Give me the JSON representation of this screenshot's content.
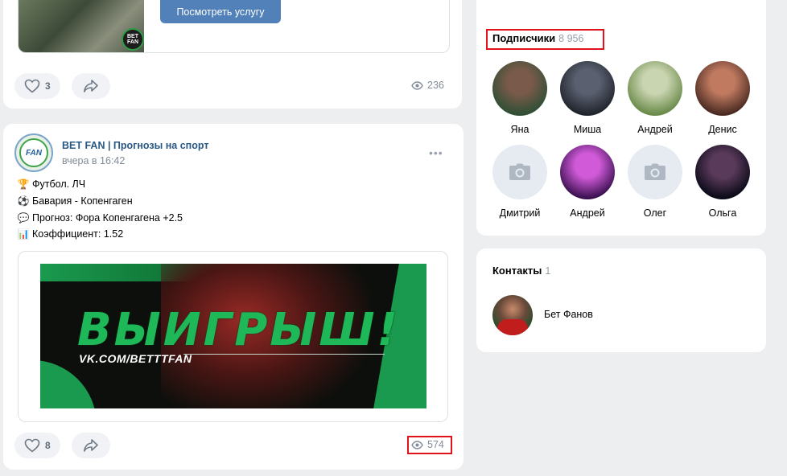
{
  "post1": {
    "snippet_button": "Посмотреть услугу",
    "snippet_logo": "BET FAN",
    "likes": "3",
    "views": "236"
  },
  "post2": {
    "author": "BET FAN | Прогнозы на спорт",
    "time": "вчера в 16:42",
    "avatar_text": "FAN",
    "lines": [
      {
        "icon": "trophy-icon",
        "glyph": "🏆",
        "text": "Футбол. ЛЧ"
      },
      {
        "icon": "soccer-ball-icon",
        "glyph": "⚽",
        "text": "Бавария - Копенгаген"
      },
      {
        "icon": "speech-bubble-icon",
        "glyph": "💬",
        "text": "Прогноз: Фора Копенгагена +2.5"
      },
      {
        "icon": "bar-chart-icon",
        "glyph": "📊",
        "text": "Коэффициент: 1.52"
      }
    ],
    "banner_title": "ВЫИГРЫШ!",
    "banner_url": "VK.COM/BETTTFAN",
    "likes": "8",
    "views": "574"
  },
  "subscribers": {
    "title": "Подписчики",
    "count": "8 956",
    "members": [
      {
        "name": "Яна",
        "photo": "photo",
        "color_a": "#7a5a4a",
        "color_b": "#2f4f35"
      },
      {
        "name": "Миша",
        "photo": "photo",
        "color_a": "#5a6070",
        "color_b": "#20242c"
      },
      {
        "name": "Андрей",
        "photo": "photo",
        "color_a": "#c9d4b0",
        "color_b": "#6a8a4a"
      },
      {
        "name": "Денис",
        "photo": "photo",
        "color_a": "#c07a60",
        "color_b": "#4a2a22"
      },
      {
        "name": "Дмитрий",
        "photo": "camera-icon"
      },
      {
        "name": "Андрей",
        "photo": "photo",
        "color_a": "#d05ad8",
        "color_b": "#3a1050"
      },
      {
        "name": "Олег",
        "photo": "camera-icon"
      },
      {
        "name": "Ольга",
        "photo": "photo",
        "color_a": "#5a3a5a",
        "color_b": "#0a0a18"
      }
    ]
  },
  "contacts": {
    "title": "Контакты",
    "count": "1",
    "name": "Бет Фанов"
  },
  "colors": {
    "link": "#2a5885",
    "button": "#5181b8",
    "highlight": "#e0131d",
    "banner_green": "#1eb858"
  }
}
